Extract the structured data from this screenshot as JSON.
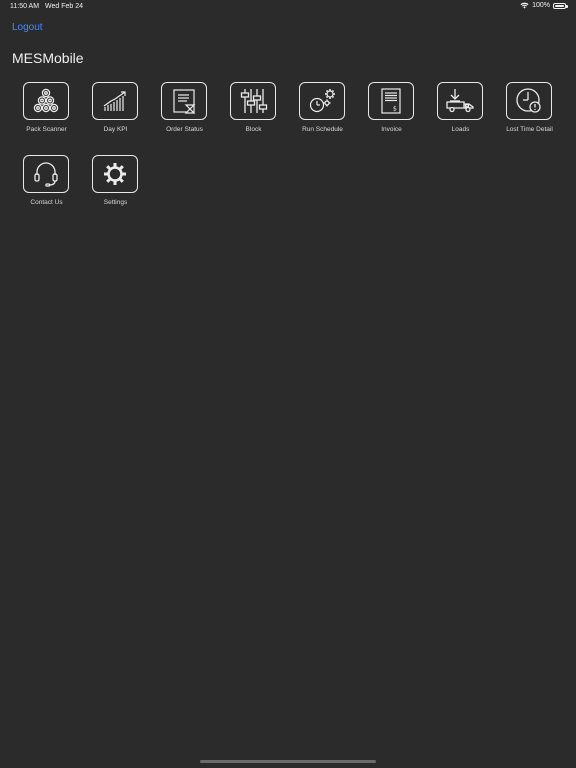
{
  "status_bar": {
    "time": "11:50 AM",
    "date": "Wed Feb 24",
    "battery": "100%",
    "wifi_icon": "wifi-icon",
    "battery_icon": "battery-icon"
  },
  "header": {
    "logout_label": "Logout",
    "title": "MESMobile",
    "link_color": "#3b8cff"
  },
  "tiles": [
    {
      "label": "Pack Scanner",
      "icon": "pack-scanner-icon"
    },
    {
      "label": "Day KPI",
      "icon": "chart-up-icon"
    },
    {
      "label": "Order Status",
      "icon": "order-status-icon"
    },
    {
      "label": "Block",
      "icon": "sliders-icon"
    },
    {
      "label": "Run Schedule",
      "icon": "clock-gears-icon"
    },
    {
      "label": "Invoice",
      "icon": "invoice-icon"
    },
    {
      "label": "Loads",
      "icon": "truck-download-icon"
    },
    {
      "label": "Lost Time Detail",
      "icon": "clock-alert-icon"
    },
    {
      "label": "Contact Us",
      "icon": "headset-icon"
    },
    {
      "label": "Settings",
      "icon": "gear-icon"
    }
  ]
}
